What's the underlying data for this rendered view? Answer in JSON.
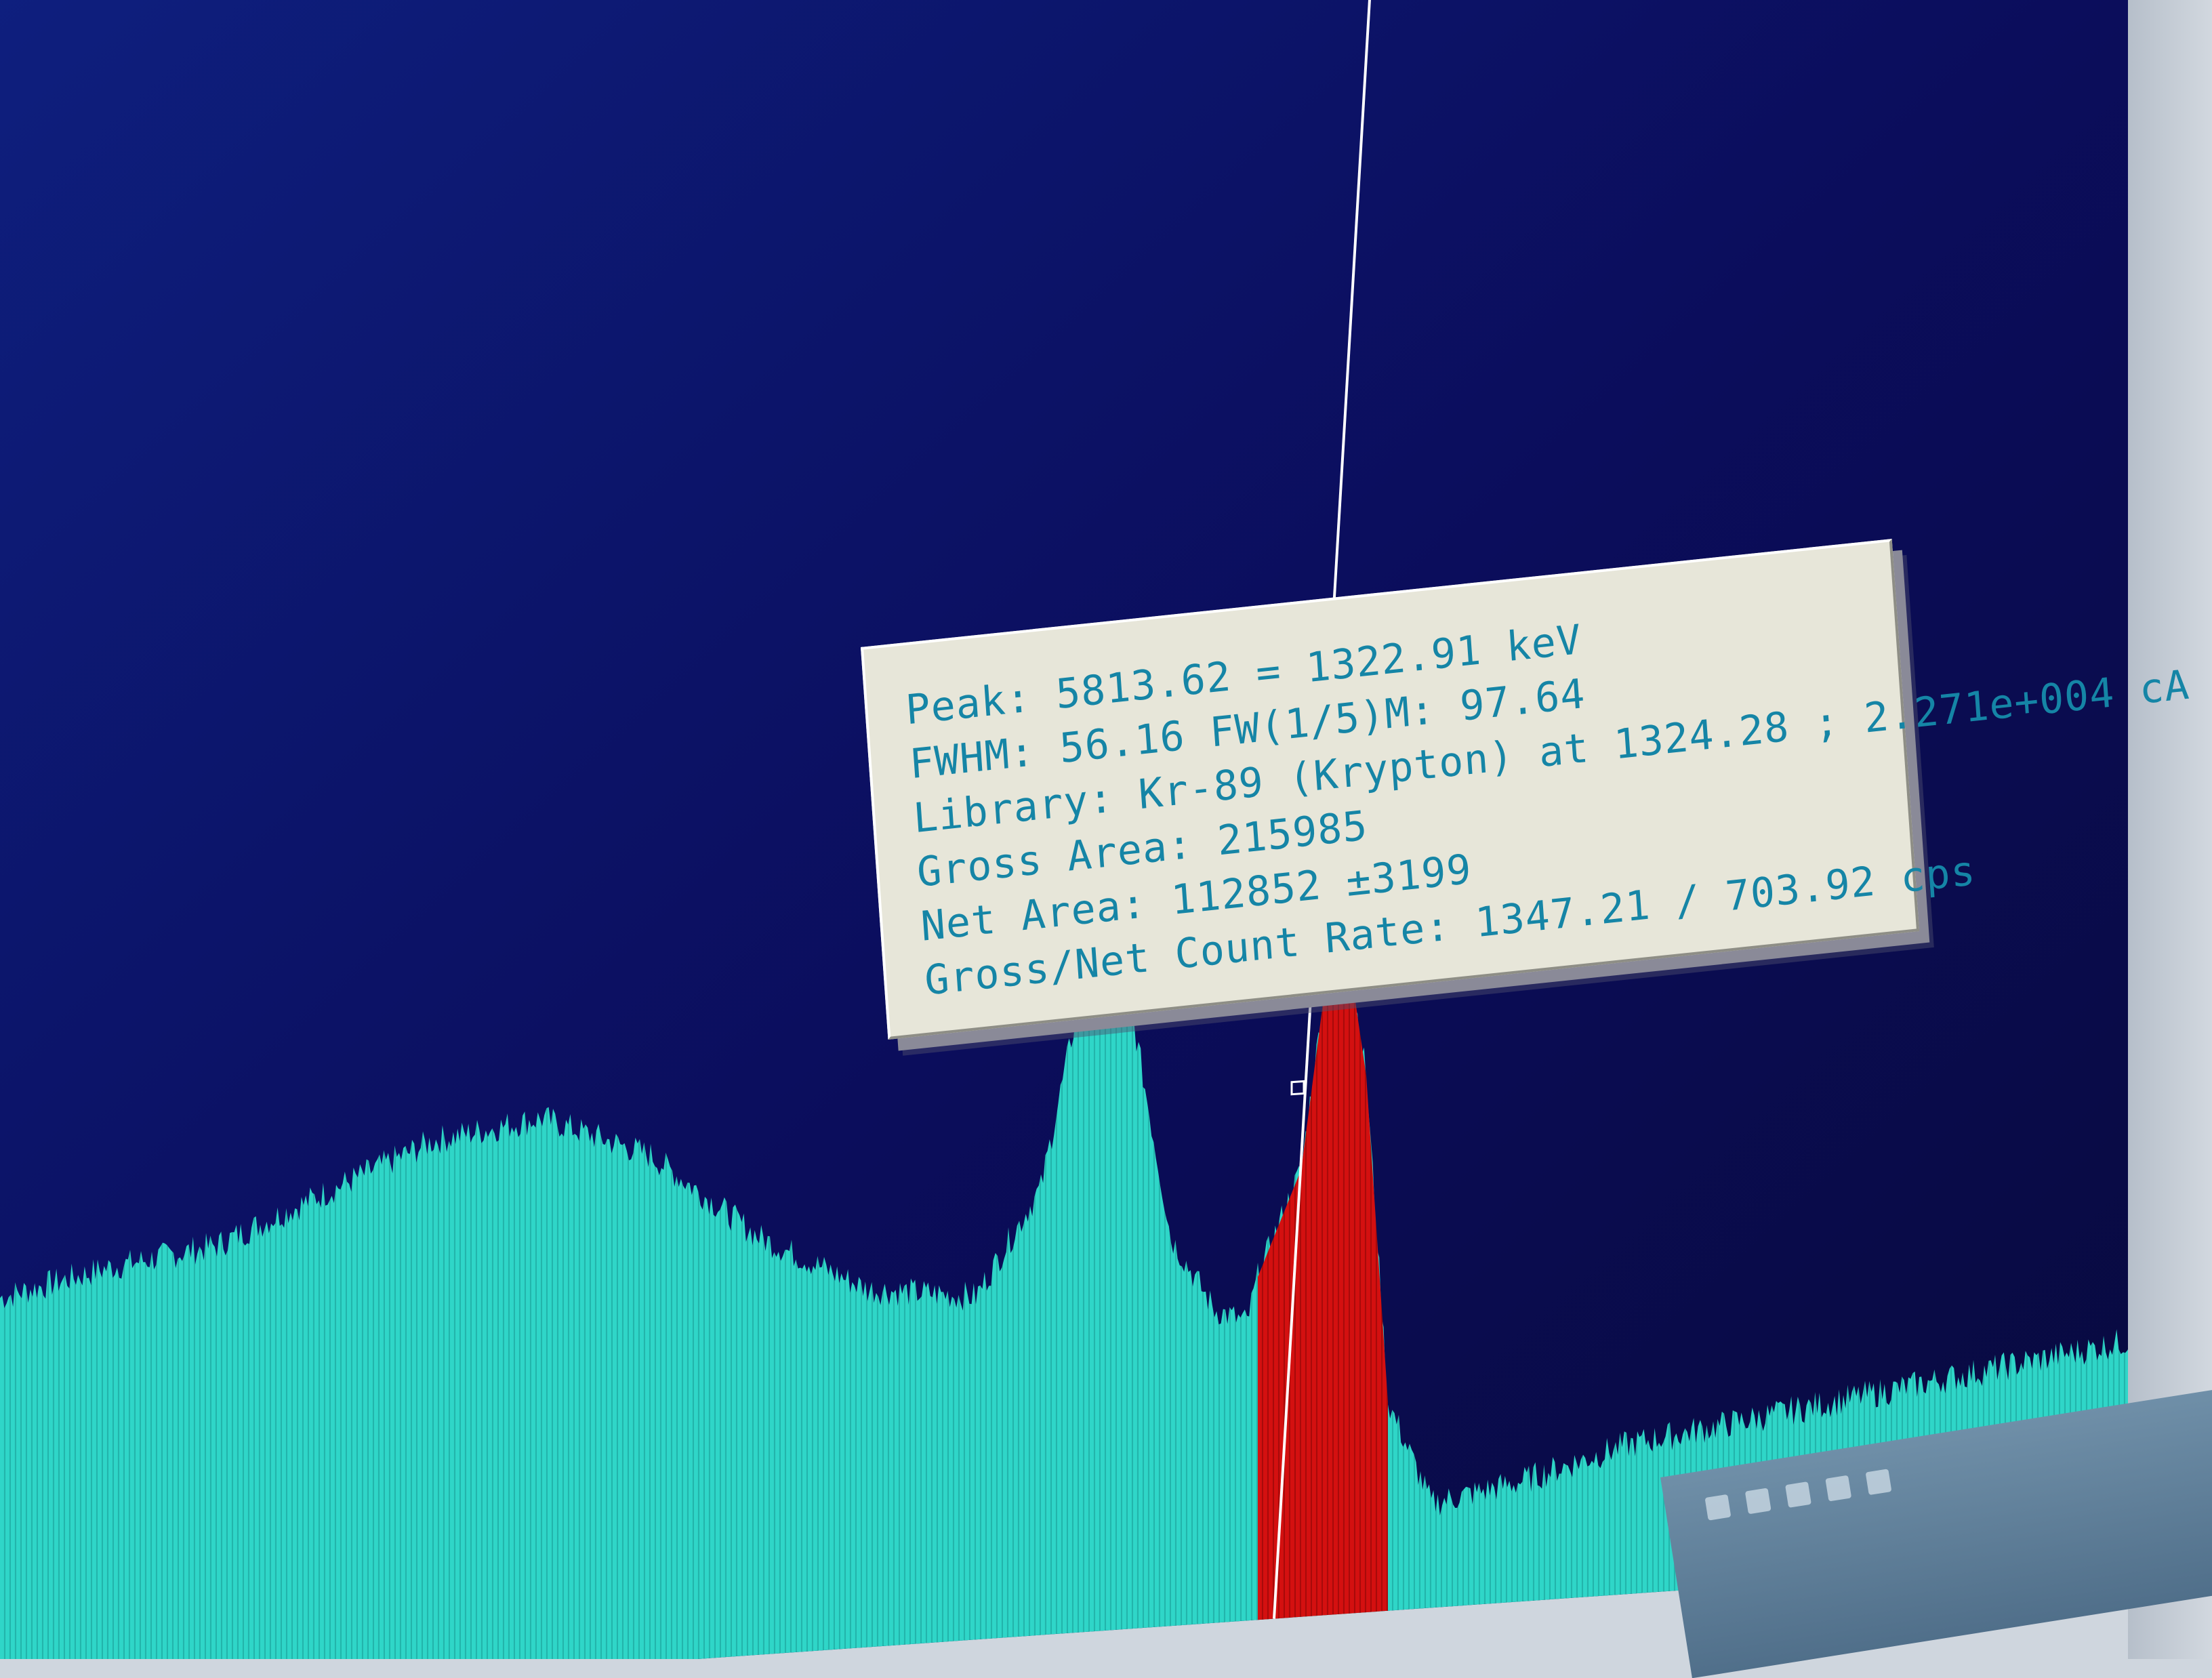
{
  "tooltip": {
    "peak": "Peak: 5813.62 = 1322.91 keV",
    "fwhm": "FWHM: 56.16  FW(1/5)M: 97.64",
    "library": "Library: Kr-89 (Krypton) at 1324.28 ;  2.271e+004 cA",
    "gross_area": "Gross Area: 215985",
    "net_area": "Net Area: 112852 ±3199",
    "count_rate": "Gross/Net Count Rate: 1347.21 / 703.92 cps"
  },
  "colors": {
    "background": "#0b0b55",
    "spectrum": "#2fd6c8",
    "roi": "#d41010",
    "cursor": "#ffffff",
    "tooltip_bg": "#e7e6d9",
    "tooltip_text": "#1585a6"
  },
  "chart_data": {
    "type": "area",
    "title": "",
    "xlabel": "",
    "ylabel": "",
    "x_units": "channel",
    "xlim": [
      0,
      1000
    ],
    "ylim": [
      0,
      100
    ],
    "grid": false,
    "cursor_x": 600,
    "roi": [
      580,
      640
    ],
    "series": [
      {
        "x": [
          0,
          50,
          100,
          150,
          200,
          250,
          300,
          350,
          400,
          450,
          480,
          500,
          520,
          540,
          560,
          575,
          580,
          600,
          610,
          620,
          630,
          640,
          660,
          700,
          750,
          800,
          850,
          900,
          950,
          1000
        ],
        "values": [
          55,
          58,
          60,
          66,
          72,
          74,
          68,
          56,
          48,
          46,
          60,
          88,
          86,
          52,
          42,
          40,
          46,
          60,
          82,
          92,
          72,
          28,
          14,
          16,
          20,
          22,
          24,
          26,
          28,
          30
        ]
      }
    ]
  }
}
